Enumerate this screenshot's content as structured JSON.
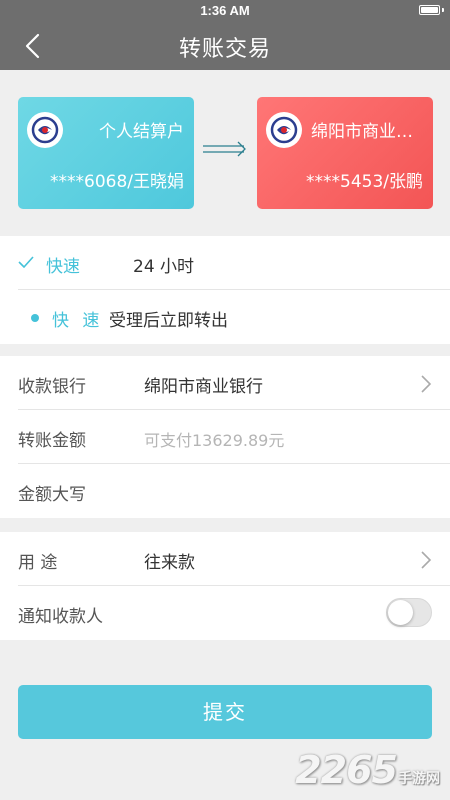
{
  "status_bar": {
    "time": "1:36 AM"
  },
  "header": {
    "title": "转账交易"
  },
  "cards": {
    "from": {
      "name": "个人结算户",
      "account": "****6068/王晓娟",
      "color": "#4ec8dc"
    },
    "to": {
      "name": "绵阳市商业银行",
      "account": "****5453/张鹏",
      "color": "#f35555"
    }
  },
  "speed": {
    "selected_label": "快速",
    "selected_hours": "24 小时",
    "option_label": "快 速",
    "option_desc": "受理后立即转出"
  },
  "form": {
    "bank_label": "收款银行",
    "bank_value": "绵阳市商业银行",
    "amount_label": "转账金额",
    "amount_placeholder": "可支付13629.89元",
    "capital_label": "金额大写",
    "purpose_label": "用 途",
    "purpose_value": "往来款",
    "notify_label": "通知收款人"
  },
  "submit": {
    "label": "提交"
  },
  "watermark": {
    "number": "2265",
    "text": "手游网"
  },
  "colors": {
    "accent": "#45c2d9",
    "header": "#6e6e6e",
    "submit": "#56c8dc"
  }
}
